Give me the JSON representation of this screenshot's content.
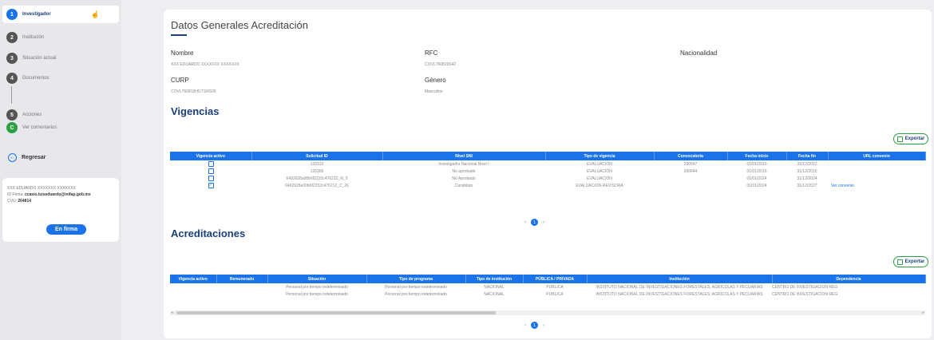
{
  "sidebar": {
    "steps": [
      {
        "num": "1",
        "label": "Investigador"
      },
      {
        "num": "2",
        "label": "Institución"
      },
      {
        "num": "3",
        "label": "Situación actual"
      },
      {
        "num": "4",
        "label": "Documentos"
      },
      {
        "num": "5",
        "label": "Acciones"
      },
      {
        "num": "C",
        "label": "Ver comentarios"
      }
    ],
    "regresar": "Regresar",
    "user": {
      "name": "XXX EDUARDO XXXXXXX XXXXXXX",
      "firma_prefix": "ID Firma:",
      "firma_email": "ccasio.luiseduardo@inifap.gob.mx",
      "cvu_prefix": "CVU:",
      "cvu": "264814"
    },
    "status_button": "En firma"
  },
  "general": {
    "title": "Datos Generales Acreditación",
    "nombre_label": "Nombre",
    "nombre_value": "XXX EDUARDO XXXXXXX XXXXXXX",
    "rfc_label": "RFC",
    "rfc_value": "COVL760819S42",
    "nacionalidad_label": "Nacionalidad",
    "curp_label": "CURP",
    "curp_value": "COVL760819HGTSRS05",
    "genero_label": "Género",
    "genero_value": "Masculino"
  },
  "vigencias": {
    "title": "Vigencias",
    "export": "Exportar",
    "headers": [
      "Vigencia activo",
      "Solicitud ID",
      "Nivel SNI",
      "Tipo de vigencia",
      "Convocatoria",
      "Fecha inicio",
      "Fecha fin",
      "URL convenio"
    ],
    "rows": [
      {
        "checked": false,
        "solicitud": "120310",
        "nivel": "Investigador Nacional Nivel I",
        "tipo": "EVALUACIÓN",
        "convocatoria": "290547",
        "inicio": "01/01/2010",
        "fin": "31/12/2012",
        "url": ""
      },
      {
        "checked": false,
        "solicitud": "120306",
        "nivel": "No aprobado",
        "tipo": "EVALUACIÓN",
        "convocatoria": "290644",
        "inicio": "01/01/2015",
        "fin": "31/12/2015",
        "url": ""
      },
      {
        "checked": false,
        "solicitud": "6492628a00b6f2232c476212_N_0",
        "nivel": "No Aprobado",
        "tipo": "EVALUACIÓN",
        "convocatoria": "",
        "inicio": "01/01/2024",
        "fin": "31/12/2024",
        "url": ""
      },
      {
        "checked": true,
        "solicitud": "6492628a00b6f2232c476212_C_26",
        "nivel": "Candidato",
        "tipo": "EVALUACION-REVISORA",
        "convocatoria": "",
        "inicio": "01/01/2024",
        "fin": "31/12/2027",
        "url": "Ver convenio"
      }
    ],
    "page": "1"
  },
  "acreditaciones": {
    "title": "Acreditaciones",
    "export": "Exportar",
    "headers": [
      "Vigencia activo",
      "Remunerado",
      "Situación",
      "Tipo de programa",
      "Tipo de institución",
      "PÚBLICA / PRIVADA",
      "Institución",
      "Dependencia"
    ],
    "rows": [
      {
        "situacion": "Personal por tiempo indeterminado",
        "programa": "Personal por tiempo indeterminado",
        "tipo_inst": "NACIONAL",
        "publica": "PUBLICA",
        "institucion": "INSTITUTO NACIONAL DE INVESTIGACIONES FORESTALES, AGRICOLAS Y PECUARIAS",
        "dependencia": "CENTRO DE INVESTIGACION REG"
      },
      {
        "situacion": "Personal por tiempo indeterminado",
        "programa": "Personal por tiempo indeterminado",
        "tipo_inst": "NACIONAL",
        "publica": "PUBLICA",
        "institucion": "INSTITUTO NACIONAL DE INVESTIGACIONES FORESTALES, AGRICOLAS Y PECUARIAS",
        "dependencia": "CENTRO DE INVESTIGACION REG"
      }
    ],
    "page": "1"
  },
  "colors": {
    "primary": "#1a73e8",
    "navy": "#1a3f7a",
    "green": "#2ea043"
  }
}
